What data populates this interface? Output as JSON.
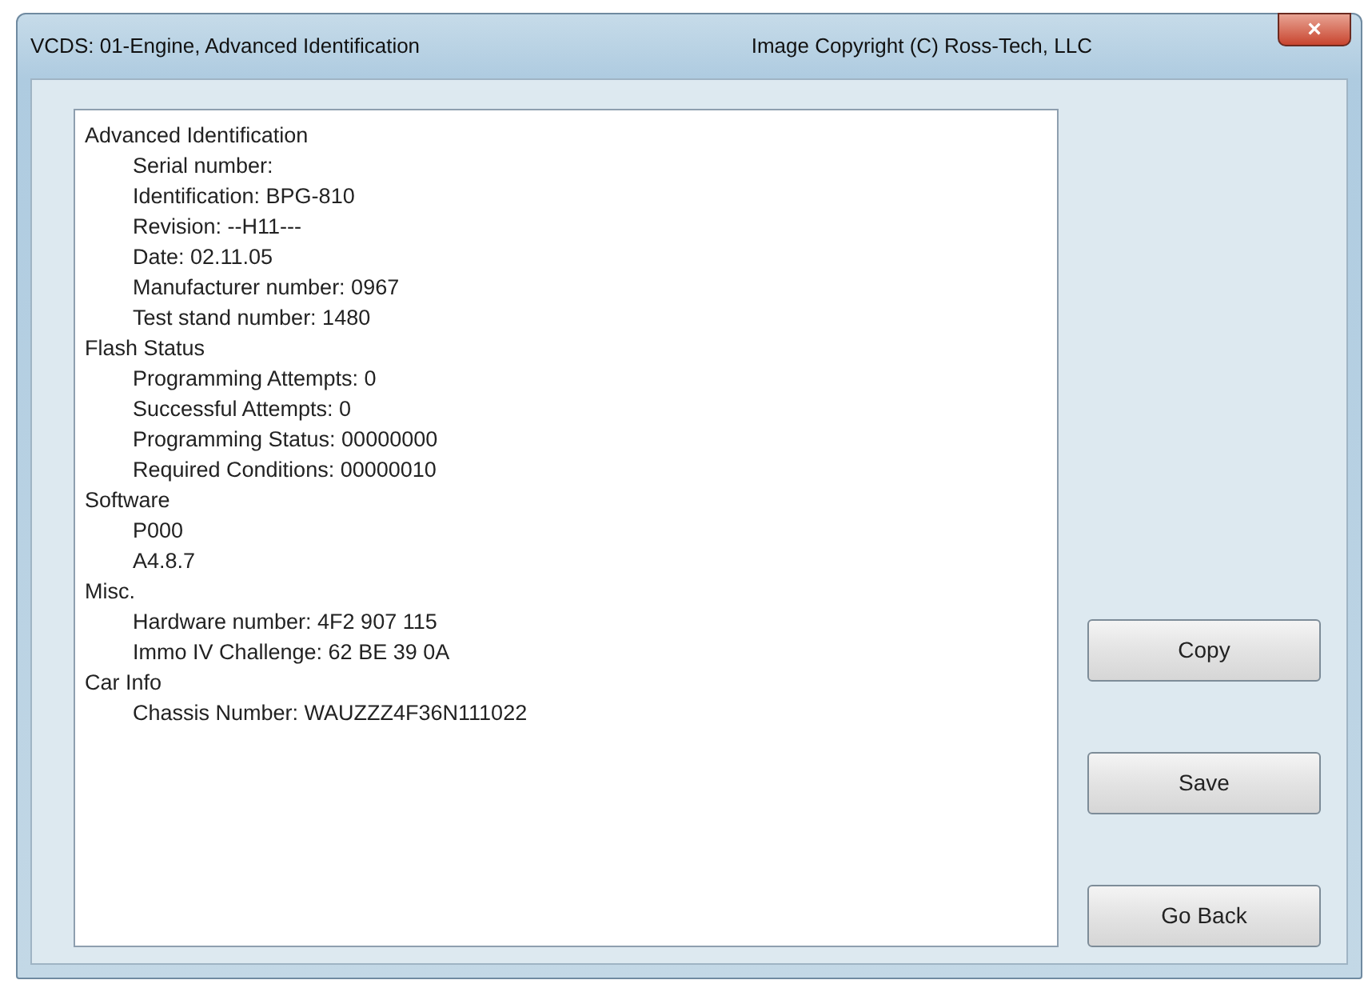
{
  "window": {
    "title": "VCDS: 01-Engine,  Advanced Identification",
    "copyright": "Image Copyright (C) Ross-Tech, LLC",
    "close": "×"
  },
  "report": [
    {
      "label": "Advanced Identification",
      "children": [
        {
          "label": "Serial number:"
        },
        {
          "label": "Identification: BPG-810"
        },
        {
          "label": "Revision: --H11---"
        },
        {
          "label": "Date: 02.11.05"
        },
        {
          "label": "Manufacturer number: 0967"
        },
        {
          "label": "Test stand number: 1480"
        }
      ]
    },
    {
      "label": "Flash Status",
      "children": [
        {
          "label": "Programming Attempts: 0"
        },
        {
          "label": "Successful Attempts: 0"
        },
        {
          "label": "Programming Status: 00000000"
        },
        {
          "label": "Required Conditions: 00000010"
        }
      ]
    },
    {
      "label": "Software",
      "children": [
        {
          "label": "P000"
        },
        {
          "label": "A4.8.7"
        }
      ]
    },
    {
      "label": "Misc.",
      "children": [
        {
          "label": "Hardware number: 4F2 907 115"
        },
        {
          "label": "Immo IV Challenge: 62 BE 39 0A"
        }
      ]
    },
    {
      "label": "Car Info",
      "children": [
        {
          "label": "Chassis Number: WAUZZZ4F36N111022"
        }
      ]
    }
  ],
  "buttons": [
    "Copy",
    "Save",
    "Go Back"
  ]
}
